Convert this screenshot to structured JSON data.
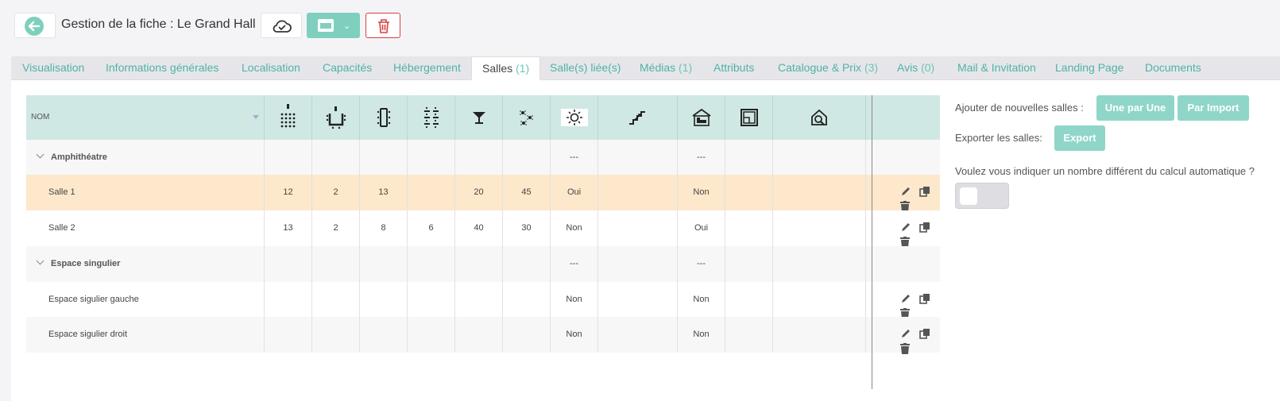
{
  "header": {
    "title": "Gestion de la fiche : Le Grand Hall",
    "icons": {
      "back": "arrow-left-icon",
      "sync": "cloud-check-icon",
      "save": "card-icon",
      "delete": "trash-icon"
    },
    "colors": {
      "accent": "#7fcfbf",
      "danger": "#d94040"
    }
  },
  "tabs": [
    {
      "label": "Visualisation",
      "count": ""
    },
    {
      "label": "Informations générales",
      "count": ""
    },
    {
      "label": "Localisation",
      "count": ""
    },
    {
      "label": "Capacités",
      "count": ""
    },
    {
      "label": "Hébergement",
      "count": ""
    },
    {
      "label": "Salles",
      "count": "(1)",
      "active": true
    },
    {
      "label": "Salle(s) liée(s)",
      "count": ""
    },
    {
      "label": "Médias",
      "count": "(1)"
    },
    {
      "label": "Attributs",
      "count": ""
    },
    {
      "label": "Catalogue & Prix",
      "count": "(3)"
    },
    {
      "label": "Avis",
      "count": "(0)"
    },
    {
      "label": "Mail & Invitation",
      "count": ""
    },
    {
      "label": "Landing Page",
      "count": ""
    },
    {
      "label": "Documents",
      "count": ""
    }
  ],
  "table": {
    "name_header": "NOM",
    "column_icons": [
      "theatre-icon",
      "u-shape-icon",
      "boardroom-icon",
      "classroom-icon",
      "cocktail-icon",
      "banquet-icon",
      "daylight-icon",
      "stairs-icon",
      "accommodation-icon",
      "floor-plan-icon",
      "search-room-icon"
    ],
    "rows": [
      {
        "type": "group",
        "name": "Amphithéatre",
        "cells": [
          "",
          "",
          "",
          "",
          "",
          "",
          "---",
          "",
          "---",
          "",
          ""
        ]
      },
      {
        "type": "item",
        "name": "Salle 1",
        "highlight": true,
        "cells": [
          "12",
          "2",
          "13",
          "",
          "20",
          "45",
          "Oui",
          "",
          "Non",
          "",
          ""
        ]
      },
      {
        "type": "item",
        "name": "Salle 2",
        "cells": [
          "13",
          "2",
          "8",
          "6",
          "40",
          "30",
          "Non",
          "",
          "Oui",
          "",
          ""
        ]
      },
      {
        "type": "group",
        "name": "Espace singulier",
        "cells": [
          "",
          "",
          "",
          "",
          "",
          "",
          "---",
          "",
          "---",
          "",
          ""
        ]
      },
      {
        "type": "item",
        "name": "Espace sigulier gauche",
        "cells": [
          "",
          "",
          "",
          "",
          "",
          "",
          "Non",
          "",
          "Non",
          "",
          ""
        ]
      },
      {
        "type": "item",
        "name": "Espace sigulier droit",
        "cells": [
          "",
          "",
          "",
          "",
          "",
          "",
          "Non",
          "",
          "Non",
          "",
          ""
        ]
      }
    ],
    "row_actions": [
      "pencil-icon",
      "copy-icon",
      "trash-icon"
    ]
  },
  "side": {
    "add_label": "Ajouter de nouvelles salles :",
    "one_by_one": "Une par Une",
    "by_import": "Par Import",
    "export_label": "Exporter les salles:",
    "export_button": "Export",
    "question": "Voulez vous indiquer un nombre différent du calcul automatique ?",
    "toggle_on": false
  }
}
